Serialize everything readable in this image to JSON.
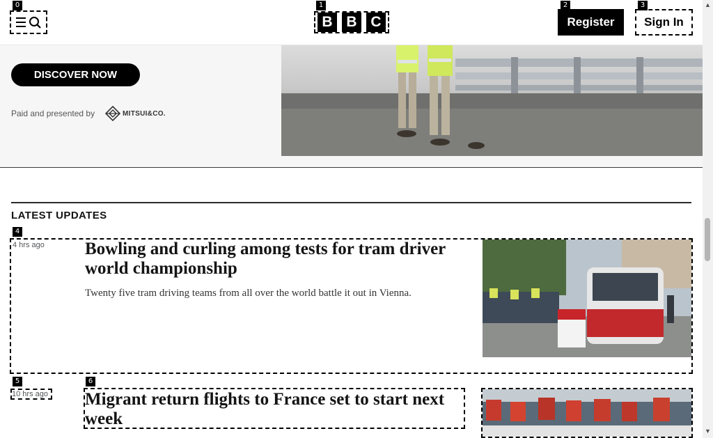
{
  "header": {
    "menu_icon": "menu-search-icon",
    "logo_letters": [
      "B",
      "B",
      "C"
    ],
    "register_label": "Register",
    "signin_label": "Sign In",
    "brand_color": "#000000"
  },
  "ad": {
    "discover_label": "DISCOVER NOW",
    "paid_text": "Paid and presented by",
    "sponsor_name": "MITSUI&CO.",
    "background_color": "#f6f6f6"
  },
  "latest": {
    "title": "LATEST UPDATES",
    "articles": [
      {
        "time": "4 hrs ago",
        "headline": "Bowling and curling among tests for tram driver world championship",
        "summary": "Twenty five tram driving teams from all over the world battle it out in Vienna."
      },
      {
        "time": "10 hrs ago",
        "headline": "Migrant return flights to France set to start next week",
        "summary": ""
      }
    ]
  },
  "tags": [
    "0",
    "1",
    "2",
    "3",
    "4",
    "5",
    "6"
  ],
  "scrollbar": {
    "up_arrow": "▲",
    "down_arrow": "▼"
  }
}
